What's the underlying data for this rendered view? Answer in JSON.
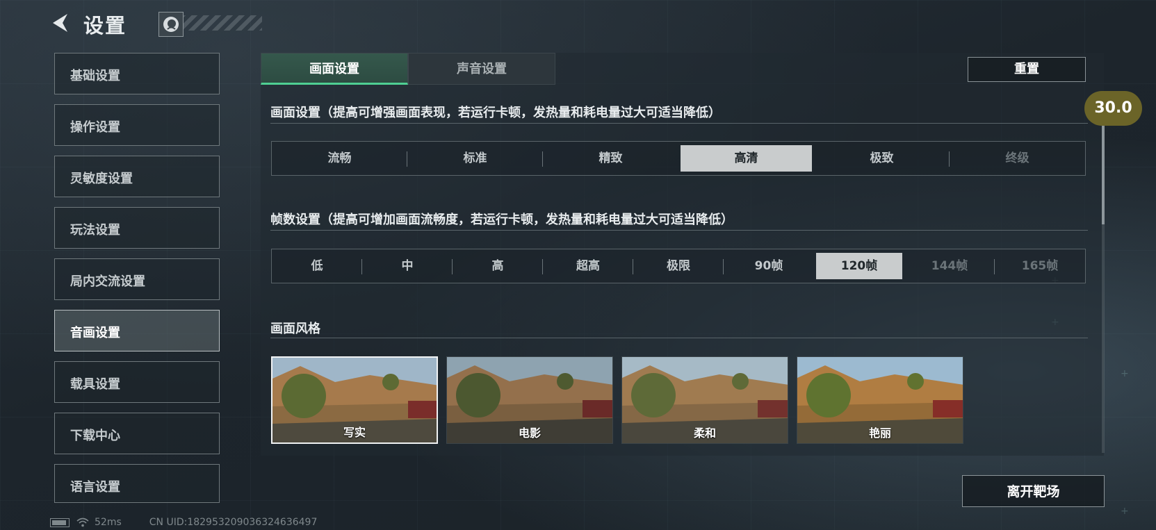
{
  "header": {
    "title": "设置"
  },
  "sidebar": {
    "items": [
      {
        "label": "基础设置"
      },
      {
        "label": "操作设置"
      },
      {
        "label": "灵敏度设置"
      },
      {
        "label": "玩法设置"
      },
      {
        "label": "局内交流设置"
      },
      {
        "label": "音画设置"
      },
      {
        "label": "载具设置"
      },
      {
        "label": "下载中心"
      },
      {
        "label": "语言设置"
      }
    ],
    "active_index": 5
  },
  "tabs": [
    {
      "label": "画面设置"
    },
    {
      "label": "声音设置"
    }
  ],
  "reset_label": "重置",
  "quality": {
    "title": "画面设置（提高可增强画面表现，若运行卡顿，发热量和耗电量过大可适当降低）",
    "options": [
      "流畅",
      "标准",
      "精致",
      "高清",
      "极致",
      "终级"
    ],
    "selected": "高清"
  },
  "framerate": {
    "title": "帧数设置（提高可增加画面流畅度，若运行卡顿，发热量和耗电量过大可适当降低）",
    "options": [
      "低",
      "中",
      "高",
      "超高",
      "极限",
      "90帧",
      "120帧",
      "144帧",
      "165帧"
    ],
    "selected": "120帧"
  },
  "style": {
    "title": "画面风格",
    "options": [
      "写实",
      "电影",
      "柔和",
      "艳丽"
    ],
    "selected": "写实"
  },
  "scroll_badge": "30.0",
  "leave_label": "离开靶场",
  "status": {
    "ping": "52ms",
    "uid": "CN UID:182953209036324636497"
  },
  "icons": {
    "back": "back-arrow-icon",
    "avatar": "avatar-icon",
    "battery": "battery-icon",
    "wifi": "wifi-icon"
  },
  "colors": {
    "accent": "#4fcf93",
    "selected_option": "#c9cccd",
    "badge": "#6b6428"
  }
}
